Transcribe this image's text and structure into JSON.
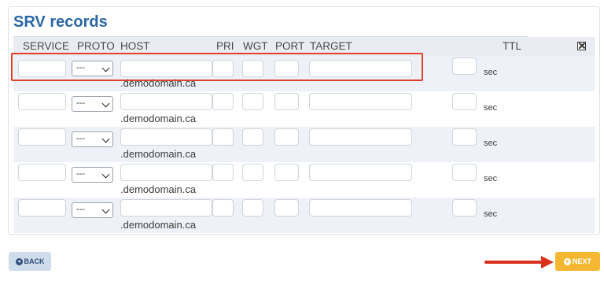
{
  "section": {
    "title": "SRV records"
  },
  "columns": {
    "service": "SERVICE",
    "proto": "PROTO",
    "host": "HOST",
    "pri": "PRI",
    "wgt": "WGT",
    "port": "PORT",
    "target": "TARGET",
    "ttl": "TTL"
  },
  "rows": [
    {
      "proto": "---",
      "domain_suffix": ".demodomain.ca",
      "ttl_unit": "sec"
    },
    {
      "proto": "---",
      "domain_suffix": ".demodomain.ca",
      "ttl_unit": "sec"
    },
    {
      "proto": "---",
      "domain_suffix": ".demodomain.ca",
      "ttl_unit": "sec"
    },
    {
      "proto": "---",
      "domain_suffix": ".demodomain.ca",
      "ttl_unit": "sec"
    },
    {
      "proto": "---",
      "domain_suffix": ".demodomain.ca",
      "ttl_unit": "sec"
    }
  ],
  "buttons": {
    "back": "BACK",
    "next": "NEXT"
  },
  "icons": {
    "delete_all": "x-box-icon",
    "back": "circle-left-arrow-icon",
    "next": "circle-right-arrow-icon",
    "annotation": "red-arrow-icon"
  },
  "colors": {
    "title": "#2a66a6",
    "highlight": "#e0432b",
    "next_button": "#f5b731",
    "back_button": "#cfdcec"
  }
}
